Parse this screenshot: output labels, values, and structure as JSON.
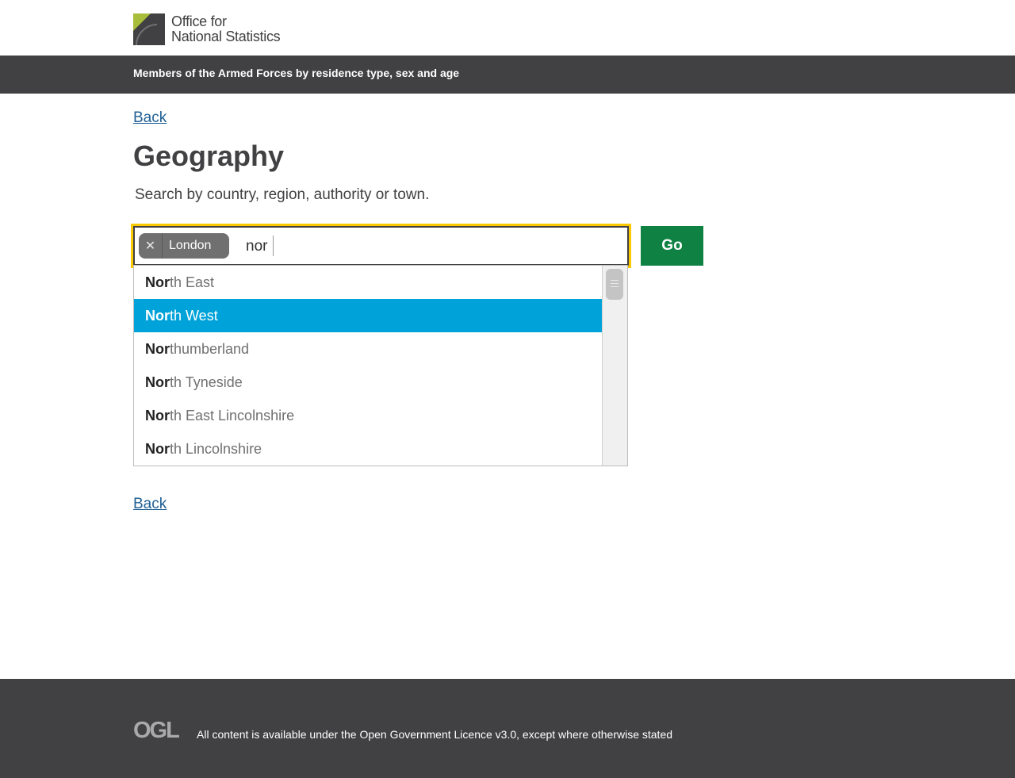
{
  "header": {
    "logo_line1": "Office for",
    "logo_line2": "National Statistics",
    "dataset_title": "Members of the Armed Forces by residence type, sex and age"
  },
  "nav": {
    "back_top": "Back",
    "back_bottom": "Back"
  },
  "main": {
    "title": "Geography",
    "hint": "Search by country, region, authority or town."
  },
  "search": {
    "selected_chip": "London",
    "chip_remove_symbol": "✕",
    "query": "nor",
    "go_label": "Go"
  },
  "suggestions": [
    {
      "match": "Nor",
      "rest": "th East",
      "active": false
    },
    {
      "match": "Nor",
      "rest": "th West",
      "active": true
    },
    {
      "match": "Nor",
      "rest": "thumberland",
      "active": false
    },
    {
      "match": "Nor",
      "rest": "th Tyneside",
      "active": false
    },
    {
      "match": "Nor",
      "rest": "th East Lincolnshire",
      "active": false
    },
    {
      "match": "Nor",
      "rest": "th Lincolnshire",
      "active": false
    }
  ],
  "footer": {
    "logo": "OGL",
    "licence_text": "All content is available under the Open Government Licence v3.0, except where otherwise stated"
  },
  "colors": {
    "header_bar": "#414042",
    "link": "#206095",
    "go_button": "#0f8243",
    "focus_ring": "#fbc900",
    "active_option": "#00a3d9",
    "chip": "#707071",
    "logo_green": "#a8bd3a"
  }
}
